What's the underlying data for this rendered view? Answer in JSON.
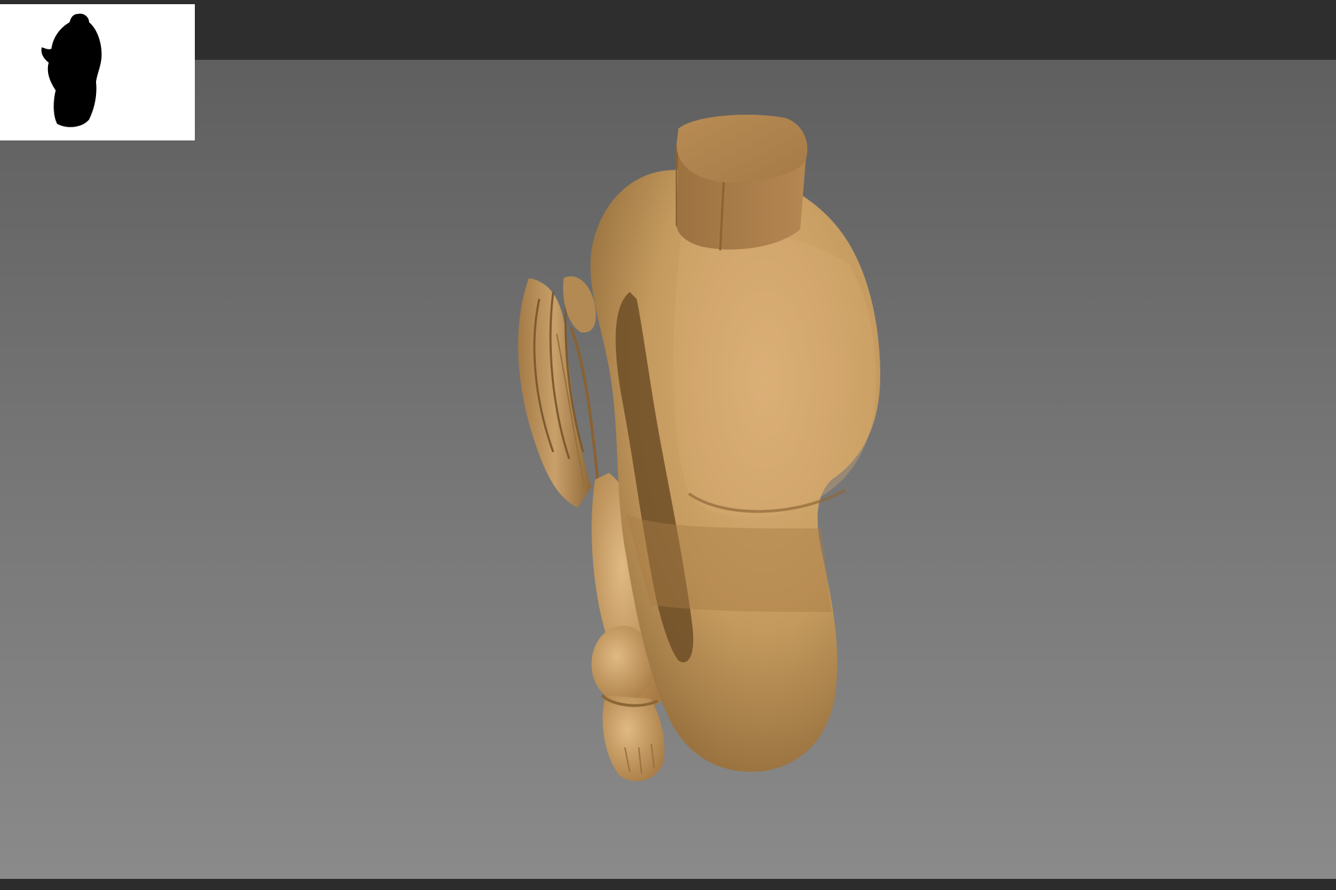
{
  "app": {
    "theme": {
      "top_bar": "#2e2e2e",
      "viewport_top": "#5f5f5f",
      "viewport_bottom": "#8a8a8a",
      "navigator_background": "#ffffff",
      "silhouette": "#000000",
      "model_material": "#c49a5e"
    }
  },
  "navigator": {
    "icon": "model-silhouette-icon"
  },
  "viewport": {
    "model": "sculpted-figure-model"
  }
}
